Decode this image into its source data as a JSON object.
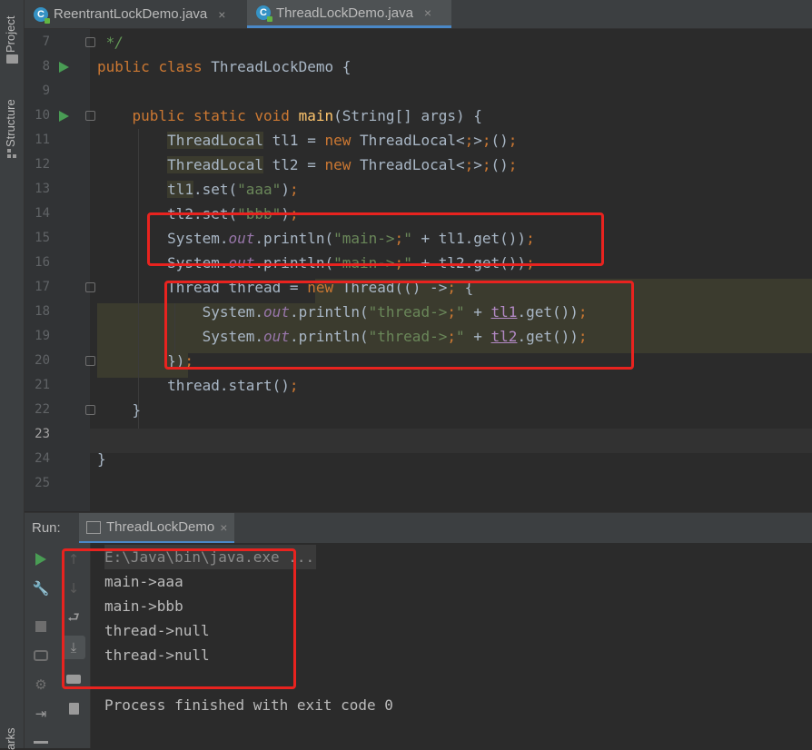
{
  "left_strip": {
    "project": "Project",
    "structure": "Structure",
    "bookmarks": "arks"
  },
  "tabs": [
    {
      "label": "ReentrantLockDemo.java",
      "active": false,
      "close": "×"
    },
    {
      "label": "ThreadLockDemo.java",
      "active": true,
      "close": "×"
    }
  ],
  "editor": {
    "line_numbers": [
      "7",
      "8",
      "9",
      "10",
      "11",
      "12",
      "13",
      "14",
      "15",
      "16",
      "17",
      "18",
      "19",
      "20",
      "21",
      "22",
      "23",
      "24",
      "25"
    ],
    "current_line": "23",
    "lines": [
      " */",
      "public class ThreadLockDemo {",
      "",
      "    public static void main(String[] args) {",
      "        ThreadLocal tl1 = new ThreadLocal<>();",
      "        ThreadLocal tl2 = new ThreadLocal<>();",
      "        tl1.set(\"aaa\");",
      "        tl2.set(\"bbb\");",
      "        System.out.println(\"main->\" + tl1.get());",
      "        System.out.println(\"main->\" + tl2.get());",
      "        Thread thread = new Thread(() -> {",
      "            System.out.println(\"thread->\" + tl1.get());",
      "            System.out.println(\"thread->\" + tl2.get());",
      "        });",
      "        thread.start();",
      "    }",
      "",
      "}",
      ""
    ]
  },
  "run_panel": {
    "label": "Run:",
    "tab": "ThreadLockDemo",
    "tab_close": "×",
    "console": [
      "E:\\Java\\bin\\java.exe ...",
      "main->aaa",
      "main->bbb",
      "thread->null",
      "thread->null",
      "",
      "Process finished with exit code 0"
    ]
  },
  "colors": {
    "keyword": "#cc7832",
    "string": "#6a8759",
    "method": "#ffc66d",
    "field": "#9876aa",
    "annotation_box": "#e8231f"
  }
}
